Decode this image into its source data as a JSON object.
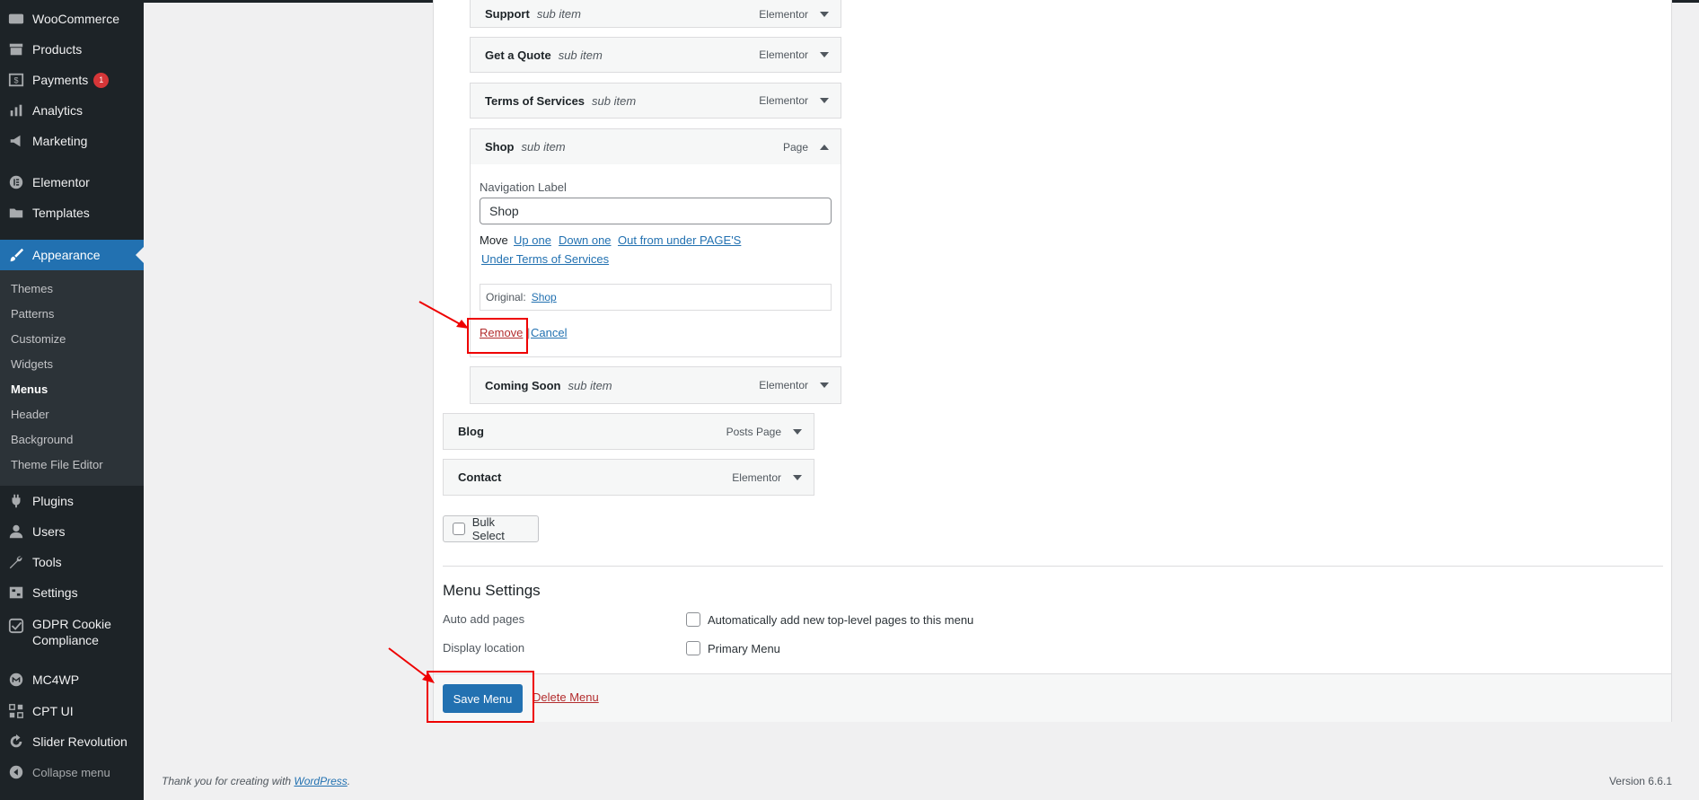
{
  "sidebar": {
    "items": [
      {
        "label": "WooCommerce",
        "icon": "woocommerce-icon"
      },
      {
        "label": "Products",
        "icon": "archive-icon"
      },
      {
        "label": "Payments",
        "icon": "dollar-icon",
        "badge": "1"
      },
      {
        "label": "Analytics",
        "icon": "bar-chart-icon"
      },
      {
        "label": "Marketing",
        "icon": "megaphone-icon"
      },
      {
        "label": "Elementor",
        "icon": "elementor-icon"
      },
      {
        "label": "Templates",
        "icon": "folder-icon"
      },
      {
        "label": "Appearance",
        "icon": "paintbrush-icon"
      },
      {
        "label": "Plugins",
        "icon": "plug-icon"
      },
      {
        "label": "Users",
        "icon": "user-icon"
      },
      {
        "label": "Tools",
        "icon": "wrench-icon"
      },
      {
        "label": "Settings",
        "icon": "settings-icon"
      },
      {
        "label": "GDPR Cookie",
        "label2": "Compliance",
        "icon": "check-shield-icon"
      },
      {
        "label": "MC4WP",
        "icon": "mc4wp-icon"
      },
      {
        "label": "CPT UI",
        "icon": "grid-icon"
      },
      {
        "label": "Slider Revolution",
        "icon": "refresh-icon"
      }
    ],
    "submenu": [
      "Themes",
      "Patterns",
      "Customize",
      "Widgets",
      "Menus",
      "Header",
      "Background",
      "Theme File Editor"
    ],
    "collapse_label": "Collapse menu"
  },
  "menu_items": {
    "support": {
      "title": "Support",
      "sub": "sub item",
      "type": "Elementor"
    },
    "get_quote": {
      "title": "Get a Quote",
      "sub": "sub item",
      "type": "Elementor"
    },
    "terms": {
      "title": "Terms of Services",
      "sub": "sub item",
      "type": "Elementor"
    },
    "shop": {
      "title": "Shop",
      "sub": "sub item",
      "type": "Page"
    },
    "coming_soon": {
      "title": "Coming Soon",
      "sub": "sub item",
      "type": "Elementor"
    },
    "blog": {
      "title": "Blog",
      "type": "Posts Page"
    },
    "contact": {
      "title": "Contact",
      "type": "Elementor"
    }
  },
  "shop_panel": {
    "nav_label": "Navigation Label",
    "nav_value": "Shop",
    "move_label": "Move",
    "move_links": [
      "Up one",
      "Down one",
      "Out from under PAGE'S",
      "Under Terms of Services"
    ],
    "original_label": "Original:",
    "original_link": "Shop",
    "remove": "Remove",
    "cancel": "Cancel"
  },
  "bulk_select": "Bulk Select",
  "menu_settings": {
    "heading": "Menu Settings",
    "auto_add_label": "Auto add pages",
    "auto_add_option": "Automatically add new top-level pages to this menu",
    "display_label": "Display location",
    "display_option": "Primary Menu"
  },
  "actions": {
    "save": "Save Menu",
    "delete": "Delete Menu"
  },
  "footer": {
    "thanks": "Thank you for creating with ",
    "wp_link": "WordPress",
    "version": "Version 6.6.1"
  },
  "colors": {
    "accent": "#2271b1",
    "sidebar": "#1d2327",
    "highlight": "#e00000",
    "danger": "#b32d2e"
  }
}
